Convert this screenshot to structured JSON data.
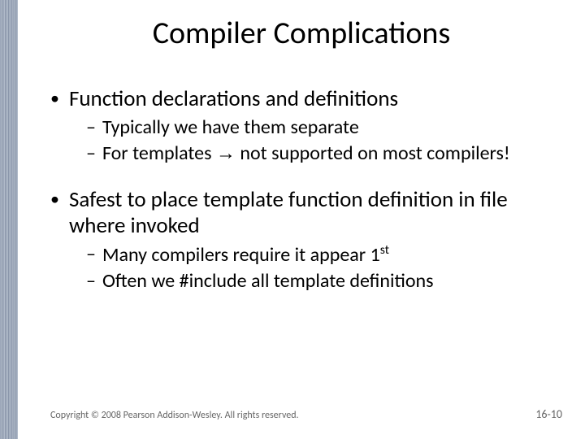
{
  "title": "Compiler Complications",
  "bullets": {
    "b1": "Function declarations and definitions",
    "b1a": "Typically we have them separate",
    "b1b_pre": "For templates ",
    "b1b_arrow": "→",
    "b1b_post": " not supported on most compilers!",
    "b2": "Safest to place template function definition in file where invoked",
    "b2a_pre": "Many compilers require it appear 1",
    "b2a_sup": "st",
    "b2b": "Often we #include all template definitions"
  },
  "footer": {
    "copyright": "Copyright © 2008 Pearson Addison-Wesley. All rights reserved.",
    "pagenum": "16-10"
  }
}
